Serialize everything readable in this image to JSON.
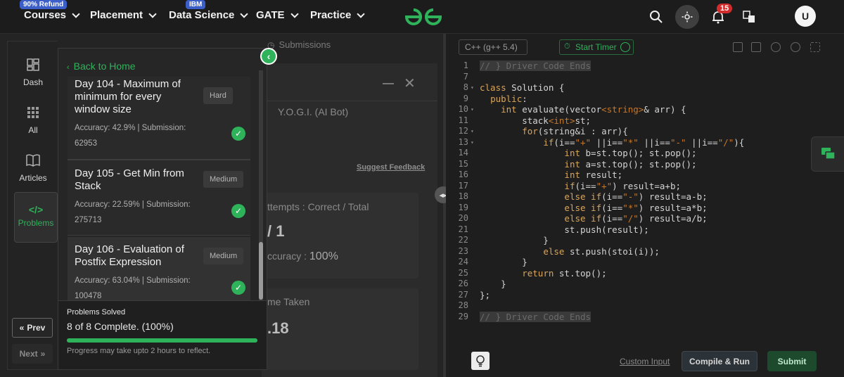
{
  "navbar": {
    "promo_badge": "90% Refund",
    "courses": "Courses",
    "placement": "Placement",
    "ibm_badge": "IBM",
    "data_science": "Data Science",
    "gate": "GATE",
    "practice": "Practice",
    "notification_count": "15",
    "avatar_initial": "U",
    "brand_color": "#2fb35a"
  },
  "middle": {
    "submissions_tab": "Submissions",
    "bot_name": "Y.O.G.I. (AI Bot)",
    "suggest_feedback": "Suggest Feedback",
    "attempts_label": "ttempts : Correct / Total",
    "attempts_value": "/ 1",
    "accuracy_label": "ccuracy :",
    "accuracy_value": "100%",
    "time_label": "me Taken",
    "time_value": ".18"
  },
  "sidebar": {
    "items": [
      {
        "label": "Dash",
        "icon": "dashboard-icon"
      },
      {
        "label": "All",
        "icon": "grid-icon"
      },
      {
        "label": "Articles",
        "icon": "book-icon"
      },
      {
        "label": "Problems",
        "icon": "code-icon"
      }
    ],
    "prev": "Prev",
    "next": "Next"
  },
  "problem_list": {
    "back": "Back to Home",
    "problems": [
      {
        "title": "Day 104 - Maximum of minimum for every window size",
        "difficulty": "Hard",
        "accuracy": "Accuracy: 42.9% | Submission: 62953"
      },
      {
        "title": "Day 105 - Get Min from Stack",
        "difficulty": "Medium",
        "accuracy": "Accuracy: 22.59% | Submission: 275713"
      },
      {
        "title": "Day 106 - Evaluation of Postfix Expression",
        "difficulty": "Medium",
        "accuracy": "Accuracy: 63.04% | Submission: 100478"
      }
    ],
    "solved_title": "Problems Solved",
    "solved_main": "8 of 8 Complete. (100%)",
    "solved_progress": 1.0,
    "solved_note": "Progress may take upto 2 hours to reflect."
  },
  "editor": {
    "language": "C++ (g++ 5.4)",
    "timer": "Start Timer",
    "custom_input": "Custom Input",
    "compile_run": "Compile & Run",
    "submit": "Submit",
    "lines": [
      {
        "n": "1",
        "html": "<span class='cm'>// } Driver Code Ends</span>"
      },
      {
        "n": "7",
        "html": ""
      },
      {
        "n": "8",
        "html": "<span class='kw'>class</span> Solution {"
      },
      {
        "n": "9",
        "html": "  <span class='kw'>public</span>:"
      },
      {
        "n": "10",
        "html": "    <span class='kw'>int</span> evaluate(vector<span class='st'>&lt;string&gt;</span>&amp; arr) {"
      },
      {
        "n": "11",
        "html": "        stack<span class='st'>&lt;int&gt;</span>st;"
      },
      {
        "n": "12",
        "html": "        <span class='kw'>for</span>(string&amp;i : arr){"
      },
      {
        "n": "13",
        "html": "            <span class='kw'>if</span>(i==<span class='st'>\"+\"</span> ||i==<span class='st'>\"*\"</span> ||i==<span class='st'>\"-\"</span> ||i==<span class='st'>\"/\"</span>){"
      },
      {
        "n": "14",
        "html": "                <span class='kw'>int</span> b=st.top(); st.pop();"
      },
      {
        "n": "15",
        "html": "                <span class='kw'>int</span> a=st.top(); st.pop();"
      },
      {
        "n": "16",
        "html": "                <span class='kw'>int</span> result;"
      },
      {
        "n": "17",
        "html": "                <span class='kw'>if</span>(i==<span class='st'>\"+\"</span>) result=a+b;"
      },
      {
        "n": "18",
        "html": "                <span class='kw'>else if</span>(i==<span class='st'>\"-\"</span>) result=a-b;"
      },
      {
        "n": "19",
        "html": "                <span class='kw'>else if</span>(i==<span class='st'>\"*\"</span>) result=a*b;"
      },
      {
        "n": "20",
        "html": "                <span class='kw'>else if</span>(i==<span class='st'>\"/\"</span>) result=a/b;"
      },
      {
        "n": "21",
        "html": "                st.push(result);"
      },
      {
        "n": "22",
        "html": "            }"
      },
      {
        "n": "23",
        "html": "            <span class='kw'>else</span> st.push(stoi(i));"
      },
      {
        "n": "24",
        "html": "        }"
      },
      {
        "n": "25",
        "html": "        <span class='kw'>return</span> st.top();"
      },
      {
        "n": "26",
        "html": "    }"
      },
      {
        "n": "27",
        "html": "};"
      },
      {
        "n": "28",
        "html": ""
      },
      {
        "n": "29",
        "html": "<span class='cm'>// } Driver Code Ends</span>"
      }
    ],
    "fold_lines": [
      "8",
      "10",
      "12",
      "13"
    ]
  }
}
